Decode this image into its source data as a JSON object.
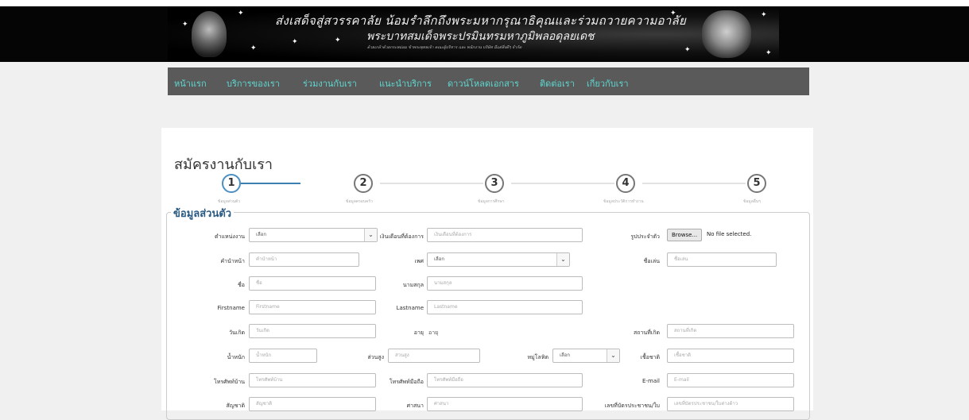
{
  "banner": {
    "line1": "ส่งเสด็จสู่สวรรคาลัย น้อมรำลึกถึงพระมหากรุณาธิคุณและร่วมถวายความอาลัย",
    "line2": "พระบาทสมเด็จพระปรมินทรมหาภูมิพลอดุลยเดช",
    "line3": "ด้วยเกล้าด้วยกระหม่อม ข้าพระพุทธเจ้า คณะผู้บริหาร และ พนักงาน บริษัท มีแต่สิ่งดีๆ จำกัด"
  },
  "nav": {
    "items": [
      "หน้าแรก",
      "บริการของเรา",
      "ร่วมงานกับเรา",
      "แนะนำบริการ",
      "ดาวน์โหลดเอกสาร",
      "ติดต่อเรา",
      "เกี่ยวกับเรา"
    ]
  },
  "page": {
    "title": "สมัครงานกับเรา",
    "section_title": "ข้อมูลส่วนตัว"
  },
  "steps": [
    {
      "number": "1",
      "label": "ข้อมูลส่วนตัว"
    },
    {
      "number": "2",
      "label": "ข้อมูลครอบครัว"
    },
    {
      "number": "3",
      "label": "ข้อมูลการศึกษา"
    },
    {
      "number": "4",
      "label": "ข้อมูลประวัติการทำงาน"
    },
    {
      "number": "5",
      "label": "ข้อมูลอื่นๆ"
    }
  ],
  "form": {
    "position": {
      "label": "ตำแหน่งงาน",
      "value": "เลือก"
    },
    "salary": {
      "label": "เงินเดือนที่ต้องการ",
      "placeholder": "เงินเดือนที่ต้องการ"
    },
    "photo": {
      "label": "รูปประจำตัว",
      "button": "Browse...",
      "status": "No file selected."
    },
    "prefix": {
      "label": "คำนำหน้า",
      "placeholder": "คำนำหน้า"
    },
    "gender": {
      "label": "เพศ",
      "value": "เลือก"
    },
    "nickname": {
      "label": "ชื่อเล่น",
      "placeholder": "ชื่อเล่น"
    },
    "name": {
      "label": "ชื่อ",
      "placeholder": "ชื่อ"
    },
    "surname": {
      "label": "นามสกุล",
      "placeholder": "นามสกุล"
    },
    "firstname": {
      "label": "Firstname",
      "placeholder": "Firstname"
    },
    "lastname": {
      "label": "Lastname",
      "placeholder": "Lastname"
    },
    "birthdate": {
      "label": "วันเกิด",
      "placeholder": "วันเกิด"
    },
    "age": {
      "label": "อายุ",
      "value": "อายุ"
    },
    "birthplace": {
      "label": "สถานที่เกิด",
      "placeholder": "สถานที่เกิด"
    },
    "weight": {
      "label": "น้ำหนัก",
      "placeholder": "น้ำหนัก"
    },
    "height": {
      "label": "ส่วนสูง",
      "placeholder": "ส่วนสูง"
    },
    "blood": {
      "label": "หมู่โลหิต",
      "value": "เลือก"
    },
    "race": {
      "label": "เชื้อชาติ",
      "placeholder": "เชื้อชาติ"
    },
    "home_phone": {
      "label": "โทรศัพท์บ้าน",
      "placeholder": "โทรศัพท์บ้าน"
    },
    "mobile": {
      "label": "โทรศัพท์มือถือ",
      "placeholder": "โทรศัพท์มือถือ"
    },
    "email": {
      "label": "E-mail",
      "placeholder": "E-mail"
    },
    "nationality": {
      "label": "สัญชาติ",
      "placeholder": "สัญชาติ"
    },
    "religion": {
      "label": "ศาสนา",
      "placeholder": "ศาสนา"
    },
    "idcard": {
      "label": "เลขที่บัตรประชาชน/ใบ",
      "placeholder": "เลขที่บัตรประชาชน/ใบต่างด้าว"
    }
  }
}
